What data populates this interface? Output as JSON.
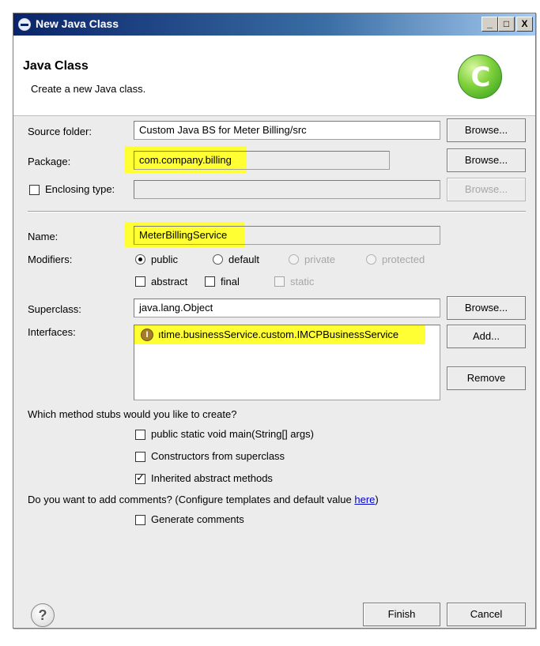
{
  "window": {
    "title": "New Java Class",
    "controls": [
      "_",
      "□",
      "X"
    ]
  },
  "header": {
    "title": "Java Class",
    "subtitle": "Create a new Java class.",
    "icon": "class-c-icon"
  },
  "source_folder": {
    "label": "Source folder:",
    "value": "Custom Java BS for Meter Billing/src",
    "button": "Browse..."
  },
  "package": {
    "label": "Package:",
    "value": "com.company.billing",
    "button": "Browse..."
  },
  "enclosing_type": {
    "label": "Enclosing type:",
    "checked": false,
    "value": "",
    "button": "Browse..."
  },
  "name": {
    "label": "Name:",
    "value": "MeterBillingService"
  },
  "modifiers": {
    "label": "Modifiers:",
    "radios": [
      {
        "label": "public",
        "selected": true,
        "enabled": true
      },
      {
        "label": "default",
        "selected": false,
        "enabled": true
      },
      {
        "label": "private",
        "selected": false,
        "enabled": false
      },
      {
        "label": "protected",
        "selected": false,
        "enabled": false
      }
    ],
    "checks": [
      {
        "label": "abstract",
        "checked": false,
        "enabled": true
      },
      {
        "label": "final",
        "checked": false,
        "enabled": true
      },
      {
        "label": "static",
        "checked": false,
        "enabled": false
      }
    ]
  },
  "superclass": {
    "label": "Superclass:",
    "value": "java.lang.Object",
    "button": "Browse..."
  },
  "interfaces": {
    "label": "Interfaces:",
    "items": [
      "ıtime.businessService.custom.IMCPBusinessService"
    ],
    "add_button": "Add...",
    "remove_button": "Remove"
  },
  "stubs": {
    "question": "Which method stubs would you like to create?",
    "options": [
      {
        "label": "public static void main(String[] args)",
        "checked": false
      },
      {
        "label": "Constructors from superclass",
        "checked": false
      },
      {
        "label": "Inherited abstract methods",
        "checked": true
      }
    ]
  },
  "comments": {
    "question": "Do you want to add comments? (Configure templates and default value ",
    "link": "here",
    "question_end": ")",
    "option": {
      "label": "Generate comments",
      "checked": false
    }
  },
  "footer": {
    "finish_button": "Finish",
    "cancel_button": "Cancel",
    "help_symbol": "?"
  }
}
